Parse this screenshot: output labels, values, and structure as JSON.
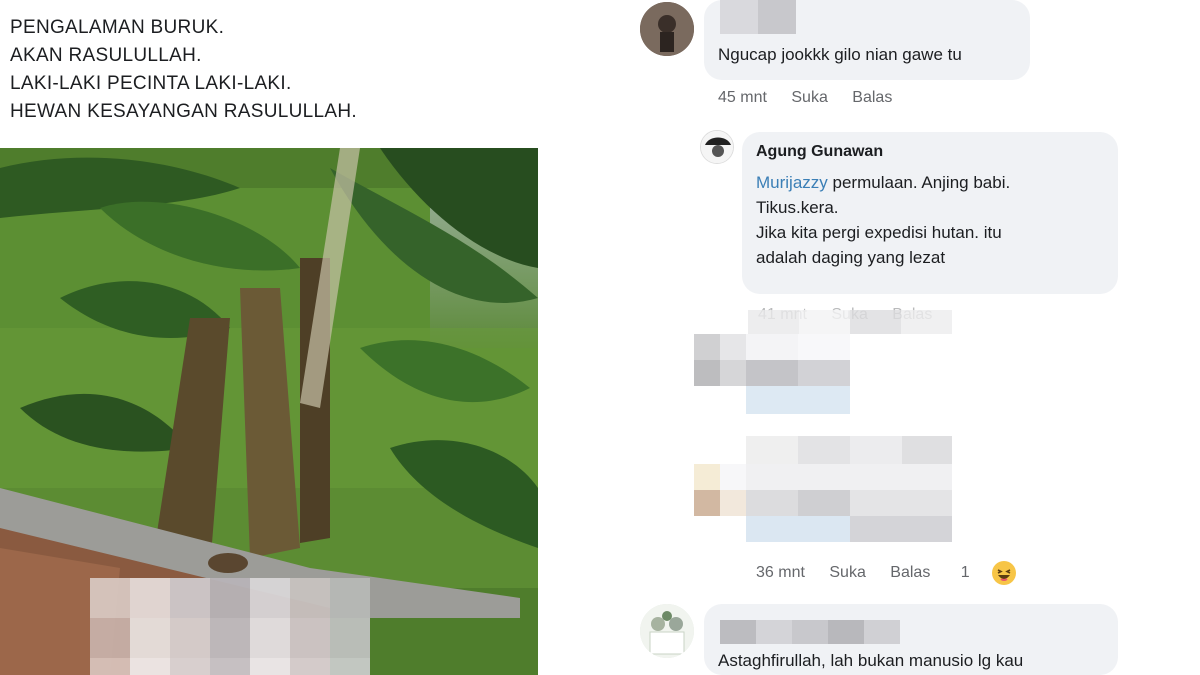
{
  "post": {
    "lines": [
      "PENGALAMAN BURUK.",
      "AKAN RASULULLAH.",
      "LAKI-LAKI PECINTA LAKI-LAKI.",
      "HEWAN KESAYANGAN RASULULLAH."
    ]
  },
  "comments": {
    "c1": {
      "text": "Ngucap jookkk gilo nian gawe tu",
      "time": "45 mnt",
      "like": "Suka",
      "reply": "Balas"
    },
    "c2": {
      "author": "Agung Gunawan",
      "mention": "Murijazzy",
      "line1_rest": " permulaan. Anjing babi.",
      "line2": "Tikus.kera.",
      "line3": "Jika kita pergi expedisi hutan. itu",
      "line4": "adalah daging yang lezat",
      "time": "41 mnt",
      "like": "Suka",
      "reply": "Balas"
    },
    "c4": {
      "time": "36 mnt",
      "like": "Suka",
      "reply": "Balas",
      "reaction_count": "1"
    },
    "c5": {
      "text": "Astaghfirullah, lah bukan manusio lg kau"
    }
  },
  "colors": {
    "bubble": "#f0f2f5",
    "meta": "#65676b",
    "mention": "#3b7fb6"
  },
  "icons": {
    "reaction": "haha-emoji-icon"
  }
}
